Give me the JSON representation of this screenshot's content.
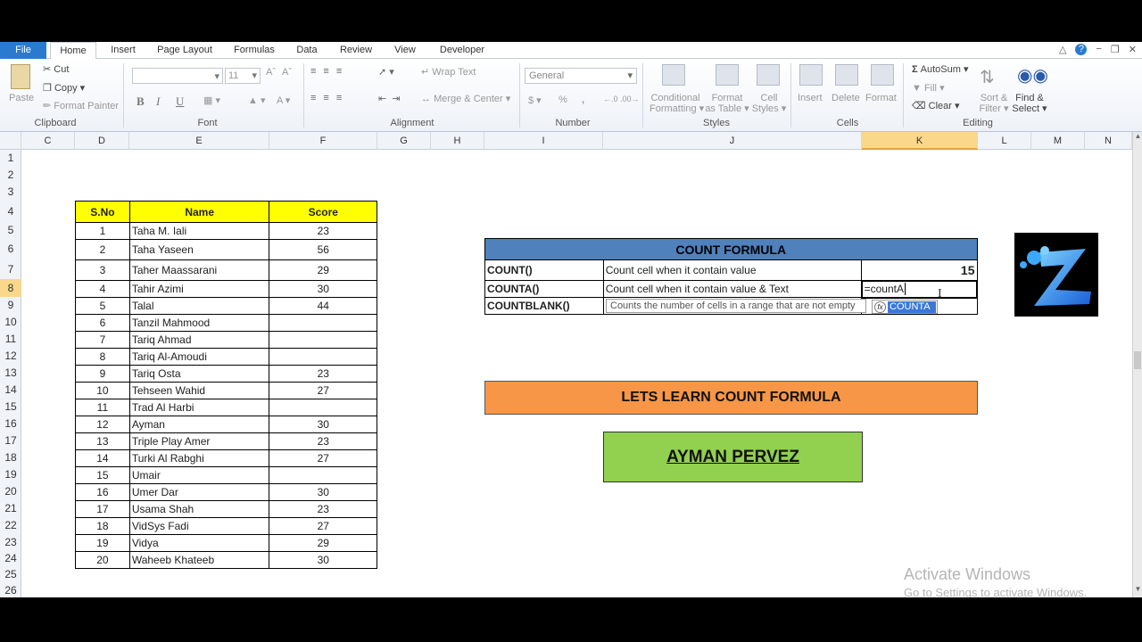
{
  "ribbon_tabs": [
    "File",
    "Home",
    "Insert",
    "Page Layout",
    "Formulas",
    "Data",
    "Review",
    "View",
    "Developer"
  ],
  "clipboard": {
    "paste": "Paste",
    "cut": "Cut",
    "copy": "Copy",
    "format_painter": "Format Painter",
    "group": "Clipboard"
  },
  "font": {
    "size": "11",
    "bold": "B",
    "italic": "I",
    "underline": "U",
    "group": "Font"
  },
  "alignment": {
    "wrap": "Wrap Text",
    "merge": "Merge & Center",
    "group": "Alignment"
  },
  "number": {
    "format": "General",
    "group": "Number",
    "percent": "%",
    "comma": ","
  },
  "styles": {
    "cond1": "Conditional",
    "cond2": "Formatting",
    "table1": "Format",
    "table2": "as Table",
    "cell1": "Cell",
    "cell2": "Styles",
    "group": "Styles"
  },
  "cells": {
    "insert": "Insert",
    "delete": "Delete",
    "format": "Format",
    "group": "Cells"
  },
  "editing": {
    "autosum": "AutoSum",
    "fill": "Fill",
    "clear": "Clear",
    "sort1": "Sort &",
    "sort2": "Filter",
    "find1": "Find &",
    "find2": "Select",
    "group": "Editing"
  },
  "columns": [
    "C",
    "D",
    "E",
    "F",
    "G",
    "H",
    "I",
    "J",
    "K",
    "L",
    "M",
    "N"
  ],
  "rows": [
    "1",
    "2",
    "3",
    "4",
    "5",
    "6",
    "7",
    "8",
    "9",
    "10",
    "11",
    "12",
    "13",
    "14",
    "15",
    "16",
    "17",
    "18",
    "19",
    "20",
    "21",
    "22",
    "23",
    "24",
    "25",
    "26"
  ],
  "score_table": {
    "headers": [
      "S.No",
      "Name",
      "Score"
    ],
    "rows": [
      [
        "1",
        "Taha M. Iali",
        "23"
      ],
      [
        "2",
        "Taha Yaseen",
        "56"
      ],
      [
        "3",
        "Taher Maassarani",
        "29"
      ],
      [
        "4",
        "Tahir Azimi",
        "30"
      ],
      [
        "5",
        "Talal",
        "44"
      ],
      [
        "6",
        "Tanzil Mahmood",
        ""
      ],
      [
        "7",
        "Tariq Ahmad",
        ""
      ],
      [
        "8",
        "Tariq Al-Amoudi",
        ""
      ],
      [
        "9",
        "Tariq Osta",
        "23"
      ],
      [
        "10",
        "Tehseen Wahid",
        "27"
      ],
      [
        "11",
        "Trad Al Harbi",
        ""
      ],
      [
        "12",
        "Ayman",
        "30"
      ],
      [
        "13",
        "Triple Play Amer",
        "23"
      ],
      [
        "14",
        "Turki Al Rabghi",
        "27"
      ],
      [
        "15",
        "Umair",
        ""
      ],
      [
        "16",
        "Umer Dar",
        "30"
      ],
      [
        "17",
        "Usama Shah",
        "23"
      ],
      [
        "18",
        "VidSys Fadi",
        "27"
      ],
      [
        "19",
        "Vidya",
        "29"
      ],
      [
        "20",
        "Waheeb Khateeb",
        "30"
      ]
    ]
  },
  "count_table": {
    "title": "COUNT FORMULA",
    "rows": [
      {
        "fn": "COUNT()",
        "desc": "Count cell when it contain value",
        "val": "15"
      },
      {
        "fn": "COUNTA()",
        "desc": "Count cell when it contain value & Text",
        "val": "=countA"
      },
      {
        "fn": "COUNTBLANK()",
        "desc": "",
        "val": ""
      }
    ]
  },
  "tooltip": "Counts the number of cells in a range that are not empty",
  "autocomplete": "COUNTA",
  "banner": "LETS LEARN COUNT FORMULA",
  "author": "AYMAN PERVEZ",
  "watermark": {
    "line1": "Activate Windows",
    "line2": "Go to Settings to activate Windows."
  },
  "colors": {
    "blue_header": "#4f81bd",
    "orange": "#f79646",
    "green": "#92d050",
    "yellow": "#ffff00"
  }
}
